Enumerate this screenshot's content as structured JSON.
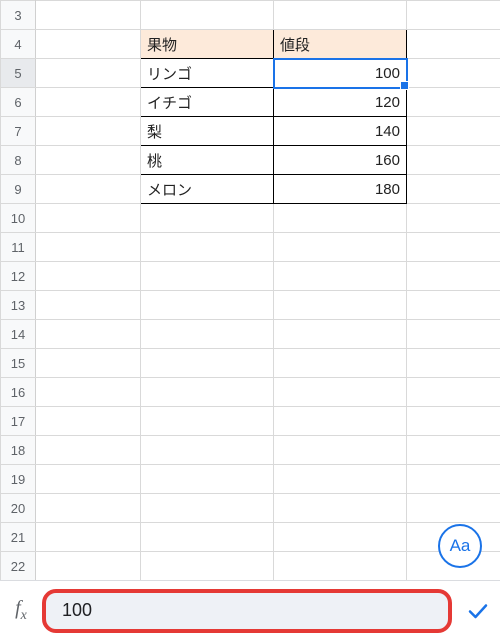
{
  "chart_data": {
    "type": "table",
    "columns": [
      "果物",
      "値段"
    ],
    "rows": [
      [
        "リンゴ",
        100
      ],
      [
        "イチゴ",
        120
      ],
      [
        "梨",
        140
      ],
      [
        "桃",
        160
      ],
      [
        "メロン",
        180
      ]
    ]
  },
  "row_start": 3,
  "row_end": 22,
  "selected_row": 5,
  "headers": {
    "fruit": "果物",
    "price": "値段"
  },
  "data": [
    {
      "fruit": "リンゴ",
      "price": "100"
    },
    {
      "fruit": "イチゴ",
      "price": "120"
    },
    {
      "fruit": "梨",
      "price": "140"
    },
    {
      "fruit": "桃",
      "price": "160"
    },
    {
      "fruit": "メロン",
      "price": "180"
    }
  ],
  "formula_bar": {
    "value": "100",
    "fx_label": "fx"
  },
  "aa_button": {
    "label": "Aa"
  }
}
